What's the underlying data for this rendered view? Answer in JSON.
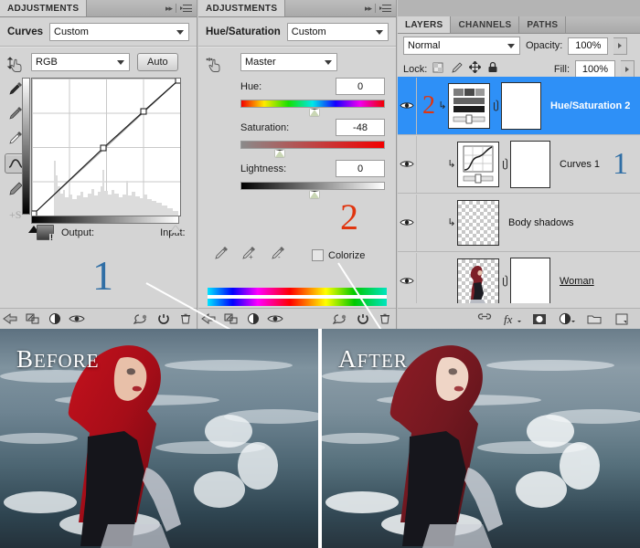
{
  "curves_panel": {
    "tab_label": "ADJUSTMENTS",
    "collapse_icon": "double-arrow-right-icon",
    "menu_icon": "panel-menu-icon",
    "title": "Curves",
    "preset": "Custom",
    "channel": "RGB",
    "auto_button": "Auto",
    "output_label": "Output:",
    "input_label": "Input:",
    "tools": [
      "targeted-adjustment-hand-icon",
      "black-point-eyedropper-icon",
      "gray-point-eyedropper-icon",
      "white-point-eyedropper-icon",
      "curve-point-tool-icon",
      "pencil-draw-curve-icon",
      "smooth-curve-icon",
      "clipping-warning-icon"
    ],
    "bottom_icons": [
      "return-arrow-icon",
      "clip-to-layer-icon",
      "adjustment-contrast-icon",
      "toggle-visibility-eye-icon",
      "preview-previous-state-icon",
      "reset-icon",
      "delete-trash-icon"
    ],
    "callout_number": "1"
  },
  "huesat_panel": {
    "tab_label": "ADJUSTMENTS",
    "collapse_icon": "double-arrow-right-icon",
    "menu_icon": "panel-menu-icon",
    "title": "Hue/Saturation",
    "preset": "Custom",
    "range": "Master",
    "hue_label": "Hue:",
    "hue_value": "0",
    "saturation_label": "Saturation:",
    "saturation_value": "-48",
    "lightness_label": "Lightness:",
    "lightness_value": "0",
    "colorize_label": "Colorize",
    "colorize_checked": false,
    "eyedroppers": [
      "sample-eyedropper-icon",
      "add-to-sample-eyedropper-icon",
      "subtract-from-sample-eyedropper-icon"
    ],
    "bottom_icons": [
      "return-arrow-icon",
      "clip-to-layer-icon",
      "adjustment-contrast-icon",
      "toggle-visibility-eye-icon",
      "preview-previous-state-icon",
      "reset-icon",
      "delete-trash-icon"
    ],
    "callout_number": "2"
  },
  "layers_panel": {
    "tabs": [
      "LAYERS",
      "CHANNELS",
      "PATHS"
    ],
    "active_tab": "LAYERS",
    "blend_mode": "Normal",
    "opacity_label": "Opacity:",
    "opacity_value": "100%",
    "lock_label": "Lock:",
    "lock_icons": [
      "lock-transparent-pixels-icon",
      "lock-image-pixels-brush-icon",
      "lock-position-move-icon",
      "lock-all-padlock-icon"
    ],
    "fill_label": "Fill:",
    "fill_value": "100%",
    "layers": [
      {
        "name": "Hue/Saturation 2",
        "selected": true,
        "visible": true,
        "clipped": true,
        "thumb_type": "hue-saturation-adjustment-thumbnail",
        "has_mask": true,
        "callout_number": "2",
        "callout_color": "#e0350f"
      },
      {
        "name": "Curves 1",
        "selected": false,
        "visible": true,
        "clipped": true,
        "thumb_type": "curves-adjustment-thumbnail",
        "has_mask": true,
        "callout_number": "1",
        "callout_color": "#2f6ea5"
      },
      {
        "name": "Body shadows",
        "selected": false,
        "visible": true,
        "clipped": true,
        "thumb_type": "transparent-pixel-thumbnail",
        "has_mask": false,
        "callout_number": "",
        "callout_color": ""
      },
      {
        "name": "Woman",
        "selected": false,
        "visible": true,
        "clipped": false,
        "thumb_type": "woman-photo-thumbnail",
        "has_mask": true,
        "callout_number": "",
        "callout_color": ""
      }
    ],
    "bottom_icons": [
      "link-layers-icon",
      "layer-style-fx-icon",
      "add-layer-mask-icon",
      "new-adjustment-layer-icon",
      "new-group-folder-icon",
      "new-layer-icon"
    ]
  },
  "comparison": {
    "before_label_first": "B",
    "before_label_rest": "EFORE",
    "after_label_first": "A",
    "after_label_rest": "FTER"
  },
  "colors": {
    "selection_blue": "#2e90f7",
    "callout_blue": "#2f6ea5",
    "callout_red": "#e0350f",
    "panel_gray": "#d4d4d4",
    "tabbar_gray": "#b0b0b0"
  }
}
